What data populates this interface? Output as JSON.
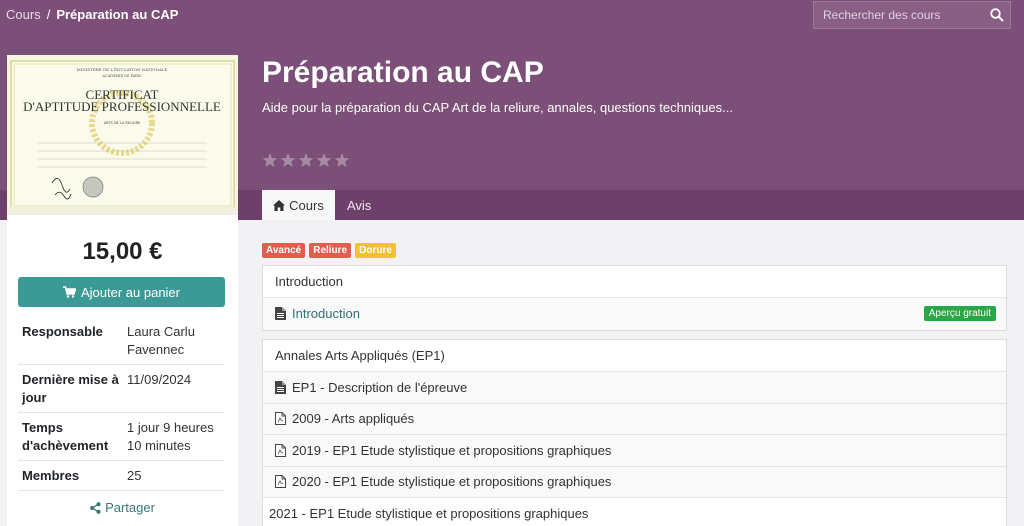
{
  "breadcrumb": {
    "root": "Cours",
    "separator": "/",
    "current": "Préparation au CAP"
  },
  "search": {
    "placeholder": "Rechercher des cours"
  },
  "course": {
    "title": "Préparation au CAP",
    "subtitle": "Aide pour la préparation du CAP Art de la reliure, annales, questions techniques...",
    "rating_stars": 5
  },
  "tabs": [
    {
      "label": "Cours",
      "icon": "home-icon"
    },
    {
      "label": "Avis"
    }
  ],
  "sidebar": {
    "certificate": {
      "line1": "MINISTÈRE DE L'ÉDUCATION NATIONALE",
      "line2": "ACADÉMIE DE PARIS",
      "title1": "CERTIFICAT",
      "title2": "D'APTITUDE PROFESSIONNELLE",
      "spec": "ARTS DE LA RELIURE"
    },
    "price": "15,00 €",
    "cart_button": "Ajouter au panier",
    "info": [
      {
        "key": "Responsable",
        "value": "Laura Carlu Favennec"
      },
      {
        "key": "Dernière mise à jour",
        "value": "11/09/2024"
      },
      {
        "key": "Temps d'achèvement",
        "value": "1 jour 9 heures 10 minutes"
      },
      {
        "key": "Membres",
        "value": "25"
      }
    ],
    "share": "Partager"
  },
  "tags": [
    {
      "label": "Avancé",
      "color": "#e35d4f"
    },
    {
      "label": "Reliure",
      "color": "#e35d4f"
    },
    {
      "label": "Dorure",
      "color": "#f2c230"
    }
  ],
  "sections": [
    {
      "title": "Introduction",
      "items": [
        {
          "label": "Introduction",
          "icon": "document-icon",
          "badge": "Aperçu gratuit"
        }
      ]
    },
    {
      "title": "Annales Arts Appliqués (EP1)",
      "items": [
        {
          "label": "EP1 - Description de l'épreuve",
          "icon": "document-icon"
        },
        {
          "label": "2009 - Arts appliqués",
          "icon": "pdf-icon"
        },
        {
          "label": "2019 - EP1 Etude stylistique et propositions graphiques",
          "icon": "pdf-icon"
        },
        {
          "label": "2020 - EP1 Etude stylistique et propositions graphiques",
          "icon": "pdf-icon"
        },
        {
          "label": "2021 - EP1 Etude stylistique et propositions graphiques",
          "icon": "pdf-icon"
        }
      ]
    }
  ],
  "colors": {
    "brand": "#7c4f78",
    "accent": "#3b9a96",
    "success": "#28a745"
  }
}
